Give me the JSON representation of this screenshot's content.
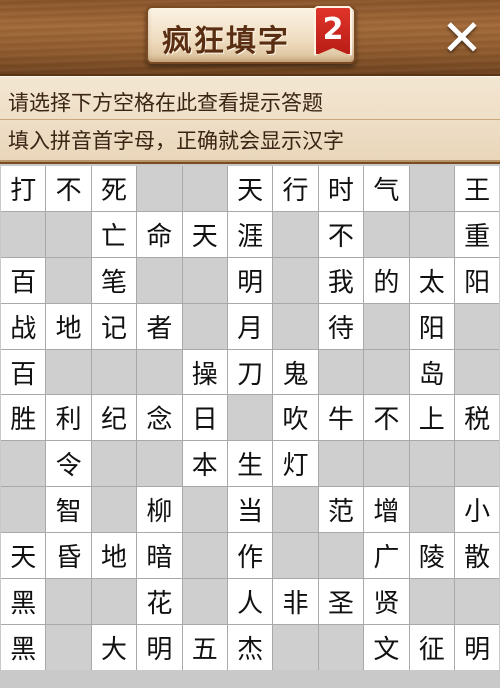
{
  "header": {
    "title": "疯狂填字",
    "level": "2",
    "close_label": "✕"
  },
  "hint": {
    "line1": "请选择下方空格在此查看提示答题",
    "line2": "填入拼音首字母，正确就会显示汉字"
  },
  "grid": [
    [
      "打",
      "不",
      "死",
      "",
      "",
      "天",
      "行",
      "时",
      "气",
      "",
      "王"
    ],
    [
      "",
      "",
      "亡",
      "命",
      "天",
      "涯",
      "",
      "不",
      "",
      "",
      "重"
    ],
    [
      "百",
      "",
      "笔",
      "",
      "",
      "明",
      "",
      "我",
      "的",
      "太",
      "阳"
    ],
    [
      "战",
      "地",
      "记",
      "者",
      "",
      "月",
      "",
      "待",
      "",
      "阳",
      ""
    ],
    [
      "百",
      "",
      "",
      "",
      "操",
      "刀",
      "鬼",
      "",
      "",
      "岛",
      ""
    ],
    [
      "胜",
      "利",
      "纪",
      "念",
      "日",
      "",
      "吹",
      "牛",
      "不",
      "上",
      "税"
    ],
    [
      "",
      "令",
      "",
      "",
      "本",
      "生",
      "灯",
      "",
      "",
      "",
      ""
    ],
    [
      "",
      "智",
      "",
      "柳",
      "",
      "当",
      "",
      "范",
      "增",
      "",
      "小"
    ],
    [
      "天",
      "昏",
      "地",
      "暗",
      "",
      "作",
      "",
      "",
      "广",
      "陵",
      "散"
    ],
    [
      "黑",
      "",
      "",
      "花",
      "",
      "人",
      "非",
      "圣",
      "贤",
      "",
      ""
    ],
    [
      "黑",
      "",
      "大",
      "明",
      "五",
      "杰",
      "",
      "",
      "文",
      "征",
      "明"
    ]
  ],
  "colors": {
    "wood": "#8f5a2c",
    "badge": "#d0281f",
    "panel": "#efdfc6",
    "cell_empty": "#cfcfcf",
    "cell_filled": "#ffffff"
  }
}
